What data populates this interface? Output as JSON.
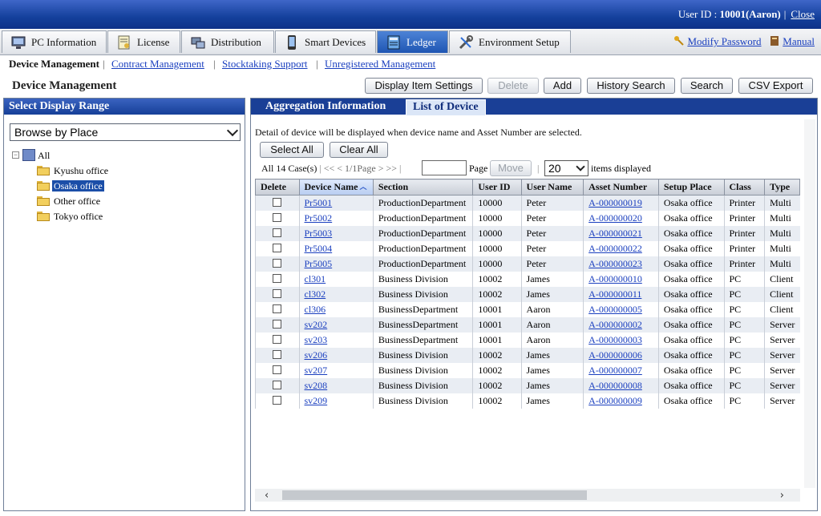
{
  "header": {
    "user_id_label": "User ID : ",
    "user_id_value": "10001(Aaron)",
    "close_label": "Close"
  },
  "tabs": [
    {
      "label": "PC Information",
      "icon": "pc-icon"
    },
    {
      "label": "License",
      "icon": "license-icon"
    },
    {
      "label": "Distribution",
      "icon": "distribution-icon"
    },
    {
      "label": "Smart Devices",
      "icon": "smartphone-icon"
    },
    {
      "label": "Ledger",
      "icon": "ledger-icon",
      "active": true
    },
    {
      "label": "Environment Setup",
      "icon": "tools-icon"
    }
  ],
  "top_links": {
    "modify_password": "Modify Password",
    "manual": "Manual"
  },
  "subnav": {
    "current": "Device Management",
    "links": [
      "Contract Management",
      "Stocktaking Support",
      "Unregistered Management"
    ]
  },
  "page_title": "Device Management",
  "toolbar": {
    "display_item_settings": "Display Item Settings",
    "delete": "Delete",
    "add": "Add",
    "history_search": "History Search",
    "search": "Search",
    "csv_export": "CSV Export"
  },
  "left_panel": {
    "title": "Select Display Range",
    "browse_select": "Browse by Place",
    "tree": {
      "root": "All",
      "children": [
        "Kyushu office",
        "Osaka office",
        "Other office",
        "Tokyo office"
      ],
      "selected": "Osaka office"
    }
  },
  "right_panel": {
    "tabs": [
      "Aggregation Information",
      "List of Device"
    ],
    "active_tab": "List of Device",
    "detail_text": "Detail of device will be displayed when device name and Asset Number are selected.",
    "select_all": "Select All",
    "clear_all": "Clear All",
    "case_count": "All 14 Case(s)",
    "pager_text": "<< < 1/1Page > >>",
    "page_input": "",
    "page_label": "Page",
    "move": "Move",
    "items_per_page": "20",
    "items_displayed": "items displayed"
  },
  "table": {
    "columns": [
      "Delete",
      "Device Name",
      "Section",
      "User ID",
      "User Name",
      "Asset Number",
      "Setup Place",
      "Class",
      "Type"
    ],
    "sorted_column": "Device Name",
    "rows": [
      [
        "Pr5001",
        "ProductionDepartment",
        "10000",
        "Peter",
        "A-000000019",
        "Osaka office",
        "Printer",
        "Multi"
      ],
      [
        "Pr5002",
        "ProductionDepartment",
        "10000",
        "Peter",
        "A-000000020",
        "Osaka office",
        "Printer",
        "Multi"
      ],
      [
        "Pr5003",
        "ProductionDepartment",
        "10000",
        "Peter",
        "A-000000021",
        "Osaka office",
        "Printer",
        "Multi"
      ],
      [
        "Pr5004",
        "ProductionDepartment",
        "10000",
        "Peter",
        "A-000000022",
        "Osaka office",
        "Printer",
        "Multi"
      ],
      [
        "Pr5005",
        "ProductionDepartment",
        "10000",
        "Peter",
        "A-000000023",
        "Osaka office",
        "Printer",
        "Multi"
      ],
      [
        "cl301",
        "Business Division",
        "10002",
        "James",
        "A-000000010",
        "Osaka office",
        "PC",
        "Client"
      ],
      [
        "cl302",
        "Business Division",
        "10002",
        "James",
        "A-000000011",
        "Osaka office",
        "PC",
        "Client"
      ],
      [
        "cl306",
        "BusinessDepartment",
        "10001",
        "Aaron",
        "A-000000005",
        "Osaka office",
        "PC",
        "Client"
      ],
      [
        "sv202",
        "BusinessDepartment",
        "10001",
        "Aaron",
        "A-000000002",
        "Osaka office",
        "PC",
        "Server"
      ],
      [
        "sv203",
        "BusinessDepartment",
        "10001",
        "Aaron",
        "A-000000003",
        "Osaka office",
        "PC",
        "Server"
      ],
      [
        "sv206",
        "Business Division",
        "10002",
        "James",
        "A-000000006",
        "Osaka office",
        "PC",
        "Server"
      ],
      [
        "sv207",
        "Business Division",
        "10002",
        "James",
        "A-000000007",
        "Osaka office",
        "PC",
        "Server"
      ],
      [
        "sv208",
        "Business Division",
        "10002",
        "James",
        "A-000000008",
        "Osaka office",
        "PC",
        "Server"
      ],
      [
        "sv209",
        "Business Division",
        "10002",
        "James",
        "A-000000009",
        "Osaka office",
        "PC",
        "Server"
      ]
    ]
  },
  "colors": {
    "header_blue": "#14409c",
    "link": "#1a3fbf",
    "selected": "#1b4ea8"
  }
}
